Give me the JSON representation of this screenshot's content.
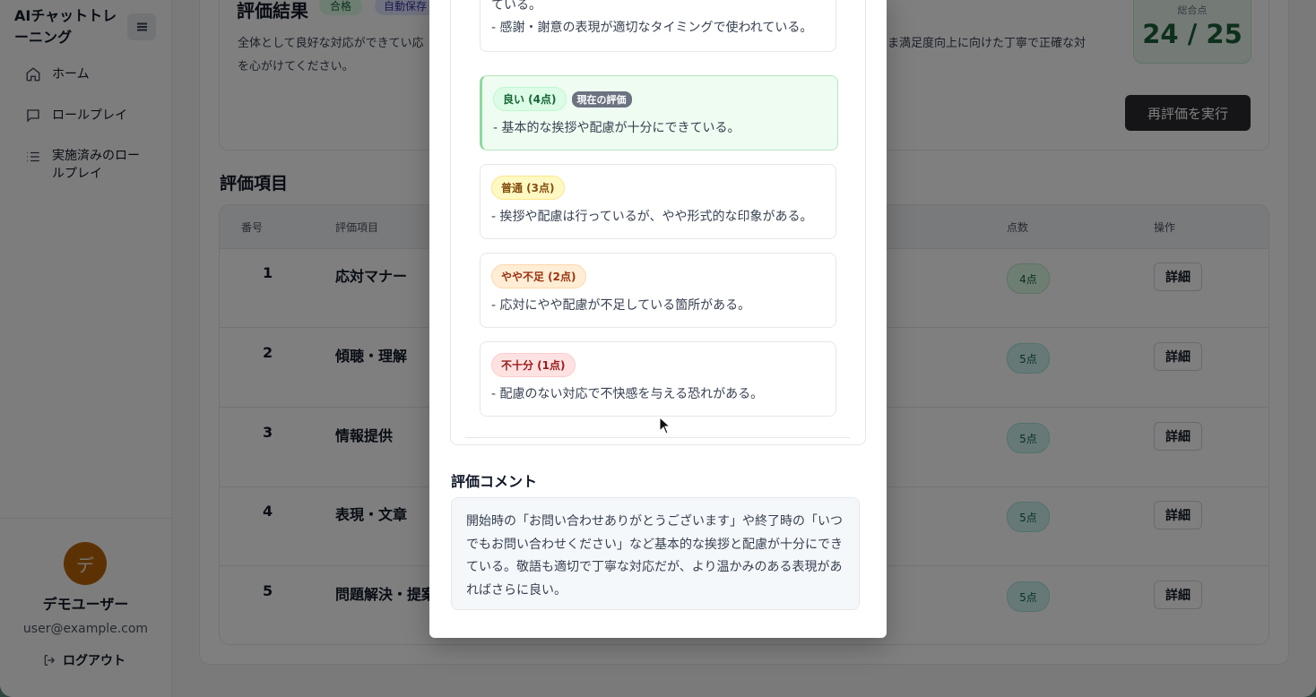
{
  "sidebar": {
    "brand": "AIチャットトレーニング",
    "nav": [
      {
        "label": "ホーム",
        "icon": "home-icon"
      },
      {
        "label": "ロールプレイ",
        "icon": "chat-icon"
      },
      {
        "label": "実施済みのロールプレイ",
        "icon": "list-icon"
      }
    ],
    "user": {
      "avatar": "デ",
      "name": "デモユーザー",
      "email": "user@example.com"
    },
    "logout": "ログアウト"
  },
  "result": {
    "title": "評価結果",
    "badge_pass": "合格",
    "badge_auto": "自動保存",
    "summary_left": "全体として良好な対応ができてい応を心がけてください。",
    "summary_right": "ま満足度向上に向けた丁寧で正確な対",
    "score_label": "総合点",
    "score": "24 / 25",
    "rerun_button": "再評価を実行"
  },
  "items": {
    "title": "評価項目",
    "headers": {
      "num": "番号",
      "item": "評価項目",
      "points": "点数",
      "action": "操作"
    },
    "rows": [
      {
        "num": "1",
        "name": "応対マナー",
        "points": "4点"
      },
      {
        "num": "2",
        "name": "傾聴・理解",
        "points": "5点"
      },
      {
        "num": "3",
        "name": "情報提供",
        "points": "5点"
      },
      {
        "num": "4",
        "name": "表現・文章",
        "points": "5点"
      },
      {
        "num": "5",
        "name": "問題解決・提案",
        "points": "5点"
      }
    ],
    "detail_label": "詳細"
  },
  "modal": {
    "top_text_1": "ている。",
    "top_text_2": "- 感謝・謝意の表現が適切なタイミングで使われている。",
    "criteria": [
      {
        "level": "良い (4点)",
        "current_tag": "現在の評価",
        "desc": "- 基本的な挨拶や配慮が十分にできている。"
      },
      {
        "level": "普通 (3点)",
        "desc": "- 挨拶や配慮は行っているが、やや形式的な印象がある。"
      },
      {
        "level": "やや不足 (2点)",
        "desc": "- 応対にやや配慮が不足している箇所がある。"
      },
      {
        "level": "不十分 (1点)",
        "desc": "- 配慮のない対応で不快感を与える恐れがある。"
      }
    ],
    "comment_title": "評価コメント",
    "comment": "開始時の「お問い合わせありがとうございます」や終了時の「いつでもお問い合わせください」など基本的な挨拶と配慮が十分にできている。敬語も適切で丁寧な対応だが、より温かみのある表現があればさらに良い。"
  }
}
